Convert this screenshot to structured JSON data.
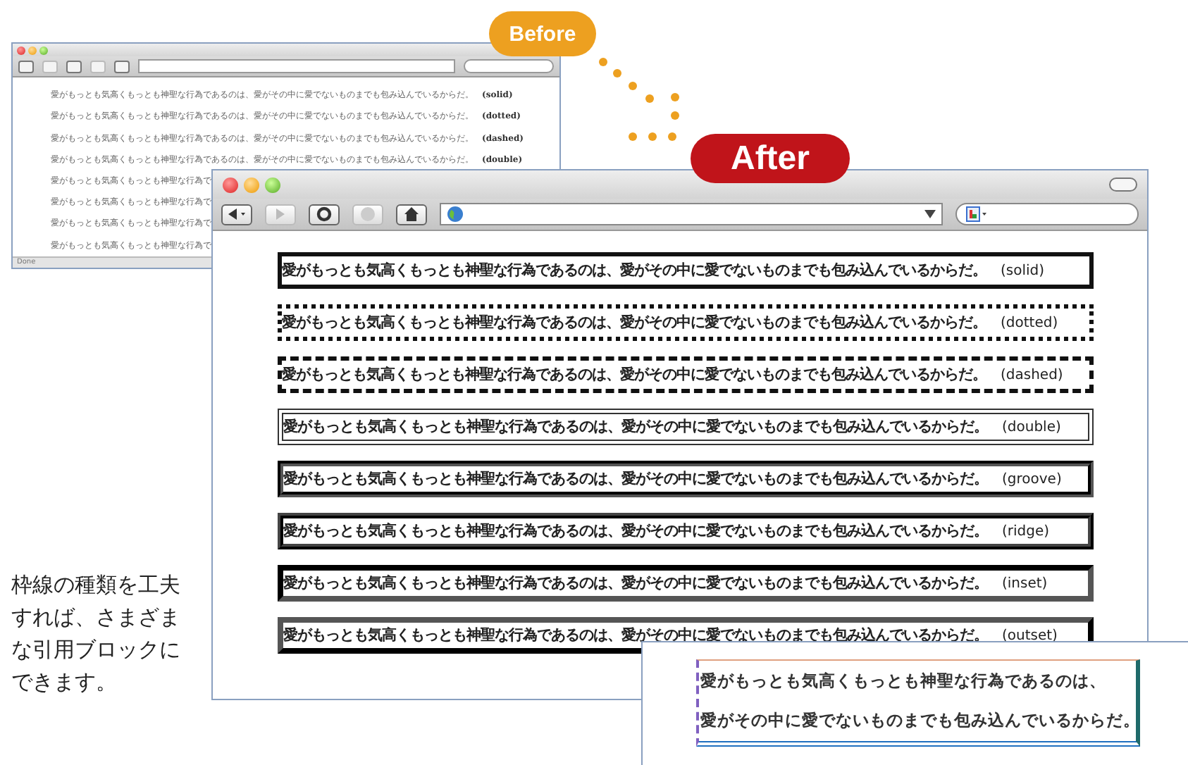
{
  "before": {
    "label": "Before",
    "rows": [
      {
        "text": "愛がもっとも気高くもっとも神聖な行為であるのは、愛がその中に愛でないものまでも包み込んでいるからだ。",
        "label": "(solid)"
      },
      {
        "text": "愛がもっとも気高くもっとも神聖な行為であるのは、愛がその中に愛でないものまでも包み込んでいるからだ。",
        "label": "(dotted)"
      },
      {
        "text": "愛がもっとも気高くもっとも神聖な行為であるのは、愛がその中に愛でないものまでも包み込んでいるからだ。",
        "label": "(dashed)"
      },
      {
        "text": "愛がもっとも気高くもっとも神聖な行為であるのは、愛がその中に愛でないものまでも包み込んでいるからだ。",
        "label": "(double)"
      },
      {
        "text": "愛がもっとも気高くもっとも神聖な行為で"
      },
      {
        "text": "愛がもっとも気高くもっとも神聖な行為で"
      },
      {
        "text": "愛がもっとも気高くもっとも神聖な行為で"
      },
      {
        "text": "愛がもっとも気高くもっとも神聖な行為で"
      }
    ],
    "status": "Done"
  },
  "after": {
    "label": "After",
    "rows": [
      {
        "kind": "solid",
        "text": "愛がもっとも気高くもっとも神聖な行為であるのは、愛がその中に愛でないものまでも包み込んでいるからだ。",
        "label": "(solid)"
      },
      {
        "kind": "dotted",
        "text": "愛がもっとも気高くもっとも神聖な行為であるのは、愛がその中に愛でないものまでも包み込んでいるからだ。",
        "label": "(dotted)"
      },
      {
        "kind": "dashed",
        "text": "愛がもっとも気高くもっとも神聖な行為であるのは、愛がその中に愛でないものまでも包み込んでいるからだ。",
        "label": "(dashed)"
      },
      {
        "kind": "double",
        "text": "愛がもっとも気高くもっとも神聖な行為であるのは、愛がその中に愛でないものまでも包み込んでいるからだ。",
        "label": "(double)"
      },
      {
        "kind": "groove",
        "text": "愛がもっとも気高くもっとも神聖な行為であるのは、愛がその中に愛でないものまでも包み込んでいるからだ。",
        "label": "(groove)"
      },
      {
        "kind": "ridge",
        "text": "愛がもっとも気高くもっとも神聖な行為であるのは、愛がその中に愛でないものまでも包み込んでいるからだ。",
        "label": "(ridge)"
      },
      {
        "kind": "inset",
        "text": "愛がもっとも気高くもっとも神聖な行為であるのは、愛がその中に愛でないものまでも包み込んでいるからだ。",
        "label": "(inset)"
      },
      {
        "kind": "outset",
        "text": "愛がもっとも気高くもっとも神聖な行為であるのは、愛がその中に愛でないものまでも包み込んでいるからだ。",
        "label": "(outset)"
      }
    ]
  },
  "caption": "枠線の種類を工夫すれば、さまざまな引用ブロックにできます。",
  "detail": {
    "lines": [
      "愛がもっとも気高くもっとも神聖な行為であるのは、",
      "愛がその中に愛でないものまでも包み込んでいるからだ。"
    ]
  }
}
